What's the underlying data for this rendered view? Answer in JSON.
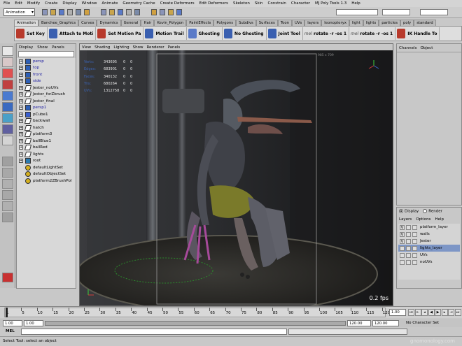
{
  "menubar": [
    "File",
    "Edit",
    "Modify",
    "Create",
    "Display",
    "Window",
    "Animate",
    "Geometry Cache",
    "Create Deformers",
    "Edit Deformers",
    "Skeleton",
    "Skin",
    "Constrain",
    "Character",
    "MJ Poly Tools 1.3",
    "Help"
  ],
  "statusline": {
    "mode": "Animation"
  },
  "shelf": {
    "tabs": [
      "Animation",
      "Banchee_Graphics",
      "Curves",
      "Dynamics",
      "General",
      "Hair",
      "Kevin_Polygon",
      "PaintEffects",
      "Polygons",
      "Subdivs",
      "Surfaces",
      "Toon",
      "UVs",
      "layers",
      "leonopteryx",
      "light",
      "lights",
      "particles",
      "poly",
      "standard"
    ],
    "active_tab": "Animation",
    "buttons": [
      {
        "label": "Set Key",
        "color": "#b83a2c"
      },
      {
        "label": "Attach to Moti",
        "color": "#3a5fb0"
      },
      {
        "label": "Set Motion Pa",
        "color": "#b83a2c"
      },
      {
        "label": "Motion Trail",
        "color": "#3a5fb0"
      },
      {
        "label": "Ghosting",
        "color": "#5a7ac8"
      },
      {
        "label": "No Ghosting",
        "color": "#3a5fb0"
      },
      {
        "label": "Joint Tool",
        "color": "#3a5fb0"
      },
      {
        "label": "rotate -r -os 1",
        "color": "#444"
      },
      {
        "label": "rotate -r -os 1",
        "color": "#444"
      },
      {
        "label": "IK Handle To",
        "color": "#b83a2c"
      }
    ],
    "mel_label": "mel"
  },
  "outliner": {
    "menu": [
      "Display",
      "Show",
      "Panels"
    ],
    "items": [
      {
        "name": "persp",
        "kind": "camera"
      },
      {
        "name": "top",
        "kind": "camera"
      },
      {
        "name": "front",
        "kind": "camera"
      },
      {
        "name": "side",
        "kind": "camera"
      },
      {
        "name": "Jester_noUVs",
        "kind": "transform"
      },
      {
        "name": "Jester_forZbrush",
        "kind": "transform"
      },
      {
        "name": "Jester_final",
        "kind": "transform"
      },
      {
        "name": "persp1",
        "kind": "camera"
      },
      {
        "name": "pCube1",
        "kind": "mesh"
      },
      {
        "name": "backwall",
        "kind": "transform"
      },
      {
        "name": "hatch",
        "kind": "transform"
      },
      {
        "name": "platform3",
        "kind": "transform"
      },
      {
        "name": "ballBlue1",
        "kind": "transform"
      },
      {
        "name": "ballRed",
        "kind": "transform"
      },
      {
        "name": "lights",
        "kind": "transform"
      },
      {
        "name": "root",
        "kind": "joint"
      },
      {
        "name": "defaultLightSet",
        "kind": "set"
      },
      {
        "name": "defaultObjectSet",
        "kind": "set"
      },
      {
        "name": "platform2ZBrushPol",
        "kind": "set"
      }
    ]
  },
  "viewport": {
    "menu": [
      "View",
      "Shading",
      "Lighting",
      "Show",
      "Renderer",
      "Panels"
    ],
    "resolution": "985 x 709",
    "hud": [
      {
        "label": "Verts:",
        "value": "343695",
        "a": "0",
        "b": "0"
      },
      {
        "label": "Edges:",
        "value": "683901",
        "a": "0",
        "b": "0"
      },
      {
        "label": "Faces:",
        "value": "340132",
        "a": "0",
        "b": "0"
      },
      {
        "label": "Tris:",
        "value": "680264",
        "a": "0",
        "b": "0"
      },
      {
        "label": "UVs:",
        "value": "1312758",
        "a": "0",
        "b": "0"
      }
    ],
    "fps": "0.2 fps"
  },
  "channelbox": {
    "menu": [
      "Channels",
      "Object"
    ]
  },
  "layereditor": {
    "modes": [
      {
        "label": "Display",
        "selected": true
      },
      {
        "label": "Render",
        "selected": false
      }
    ],
    "menu": [
      "Layers",
      "Options",
      "Help"
    ],
    "layers": [
      {
        "name": "platform_layer",
        "visible": true,
        "selected": false
      },
      {
        "name": "walls",
        "visible": true,
        "selected": false
      },
      {
        "name": "Jester",
        "visible": true,
        "selected": false
      },
      {
        "name": "lights_layer",
        "visible": false,
        "selected": true
      },
      {
        "name": "UVs",
        "visible": false,
        "selected": false
      },
      {
        "name": "noUVs",
        "visible": false,
        "selected": false
      }
    ]
  },
  "timeline": {
    "ticks": [
      "1",
      "5",
      "10",
      "15",
      "20",
      "25",
      "30",
      "35",
      "40",
      "45",
      "50",
      "55",
      "60",
      "65",
      "70",
      "75",
      "80",
      "85",
      "90",
      "95",
      "100",
      "105",
      "110",
      "115",
      "120"
    ],
    "current_frame": "1.00",
    "range_start": "1.00",
    "inner_start": "1.00",
    "inner_end": "120.00",
    "range_end": "120.00",
    "character_set": "No Character Set"
  },
  "mel": {
    "label": "MEL"
  },
  "helpline": {
    "text": "Select Tool: select an object"
  },
  "watermark": "gnomonology.com"
}
